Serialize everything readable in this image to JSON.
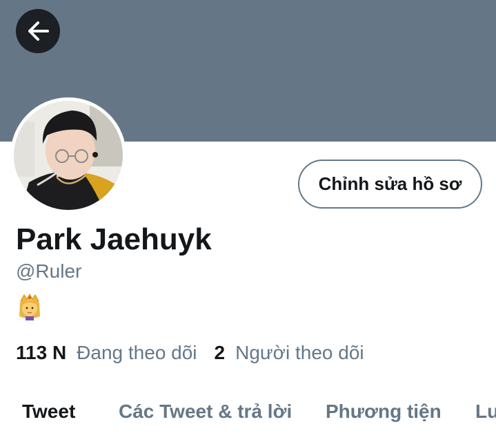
{
  "header": {
    "back_icon": "arrow-left-icon"
  },
  "profile": {
    "avatar_icon": "profile-photo",
    "edit_button_label": "Chỉnh sửa hồ sơ",
    "name": "Park Jaehuyk",
    "handle": "@Ruler",
    "bio_emoji_icon": "princess-crown-emoji"
  },
  "stats": {
    "following_count": "113 N",
    "following_label": "Đang theo dõi",
    "followers_count": "2",
    "followers_label": "Người theo dõi"
  },
  "tabs": [
    {
      "label": "Tweet",
      "active": true
    },
    {
      "label": "Các Tweet & trả lời",
      "active": false
    },
    {
      "label": "Phương tiện",
      "active": false
    },
    {
      "label": "Lượt thích",
      "active": false
    }
  ],
  "colors": {
    "banner": "#657786",
    "back_button": "#1c1f23",
    "primary_text": "#14171a",
    "secondary_text": "#657786"
  }
}
